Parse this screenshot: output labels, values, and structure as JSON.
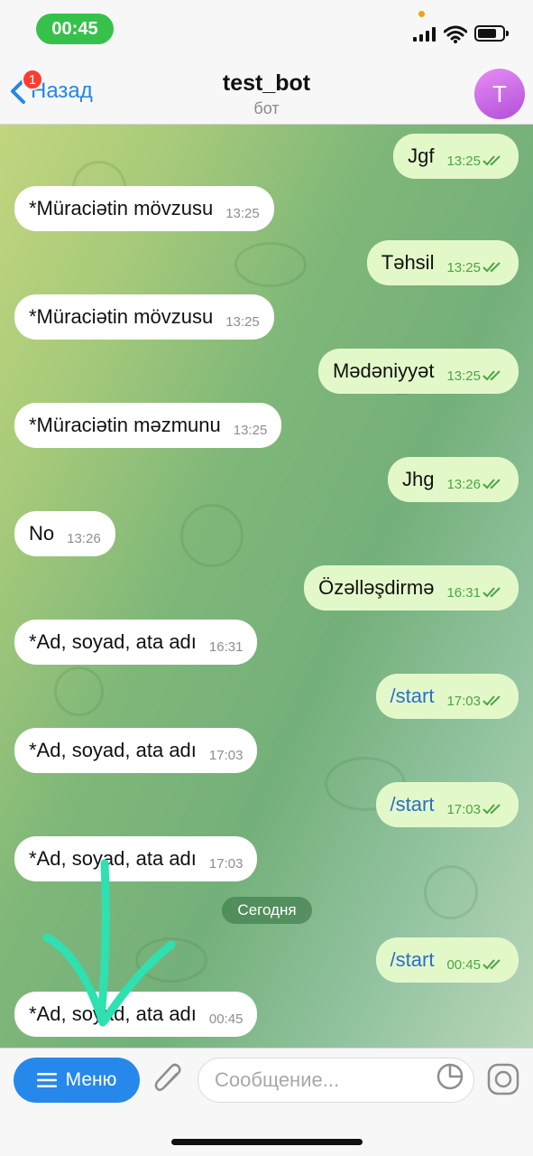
{
  "status_bar": {
    "time": "00:45"
  },
  "header": {
    "back_label": "Назад",
    "badge_count": "1",
    "title": "test_bot",
    "subtitle": "бот",
    "avatar_letter": "T"
  },
  "messages": [
    {
      "text": "Jgf",
      "time": "13:25"
    },
    {
      "text": "*Müraciətin mövzusu",
      "time": "13:25"
    },
    {
      "text": "Təhsil",
      "time": "13:25"
    },
    {
      "text": "*Müraciətin mövzusu",
      "time": "13:25"
    },
    {
      "text": "Mədəniyyət",
      "time": "13:25"
    },
    {
      "text": "*Müraciətin məzmunu",
      "time": "13:25"
    },
    {
      "text": "Jhg",
      "time": "13:26"
    },
    {
      "text": "No",
      "time": "13:26"
    },
    {
      "text": "Özəlləşdirmə",
      "time": "16:31"
    },
    {
      "text": "*Ad, soyad, ata adı",
      "time": "16:31"
    },
    {
      "text": "/start",
      "time": "17:03"
    },
    {
      "text": "*Ad, soyad, ata adı",
      "time": "17:03"
    },
    {
      "text": "/start",
      "time": "17:03"
    },
    {
      "text": "*Ad, soyad, ata adı",
      "time": "17:03"
    },
    {
      "text": "/start",
      "time": "00:45"
    },
    {
      "text": "*Ad, soyad, ata adı",
      "time": "00:45"
    }
  ],
  "date_separator": "Сегодня",
  "input_bar": {
    "menu_label": "Меню",
    "placeholder": "Сообщение..."
  },
  "colors": {
    "accent": "#2688eb",
    "outgoing_bubble": "#e3f8c9",
    "incoming_bubble": "#ffffff",
    "annotation_arrow": "#2fe0b0"
  }
}
